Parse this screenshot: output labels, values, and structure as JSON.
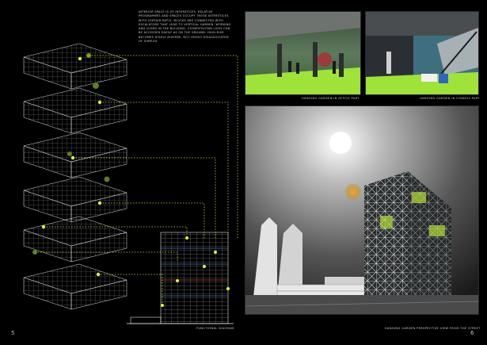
{
  "intro_text": "Interior space is of interstices. Relative programmes and spaces occupy those interstices with certain ratio. Blocks are connected with escalators that lead to vertical garden. Working and living in the building, cosmopolitan lives can be accessed easily as on the ground. High-rise becomes highly diverse, not highly disassociated of simplex",
  "captions": {
    "office": "Hanging garden in office part",
    "condo": "Hanging garden in condos part",
    "diagram": "Functional diagram",
    "perspective": "Hanging garden perspective view from the street"
  },
  "page_numbers": {
    "left": "5",
    "right": "6"
  },
  "colors": {
    "accent": "#b8e02c",
    "wire": "#d0d0d0",
    "background": "#000000"
  }
}
